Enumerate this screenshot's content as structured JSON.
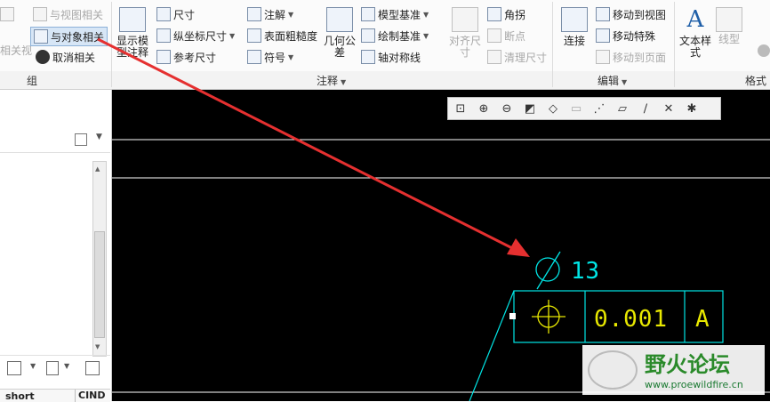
{
  "ribbon": {
    "group_section": {
      "label": "组",
      "cut_label": "相关视",
      "items": [
        "与视图相关",
        "与对象相关",
        "取消相关"
      ]
    },
    "annotate_section": {
      "label": "注释",
      "show_model_annotation": "显示模型注释",
      "col1": [
        "尺寸",
        "纵坐标尺寸",
        "参考尺寸"
      ],
      "col2": [
        "注解",
        "表面粗糙度",
        "符号"
      ],
      "geom_tol": "几何公差",
      "col3": [
        "模型基准",
        "绘制基准",
        "轴对称线"
      ],
      "align_dim": "对齐尺寸",
      "col4": [
        "角拐",
        "断点",
        "清理尺寸"
      ]
    },
    "edit_section": {
      "label": "编辑",
      "connect": "连接",
      "items": [
        "移动到视图",
        "移动特殊",
        "移动到页面"
      ]
    },
    "format_section": {
      "label": "格式",
      "text_style": "文本样式",
      "line_type": "线型"
    }
  },
  "left_panel": {
    "col_short": "short",
    "col_cind": "CIND"
  },
  "drawing": {
    "dimension_text": "∅13",
    "tolerance_value": "0.001",
    "datum": "A"
  },
  "watermark": {
    "name": "野火论坛",
    "url": "www.proewildfire.cn"
  },
  "colors": {
    "canvas": "#000000",
    "drawing_cyan": "#00e5e5",
    "drawing_yellow": "#e8e800",
    "arrow_red": "#e53030"
  }
}
